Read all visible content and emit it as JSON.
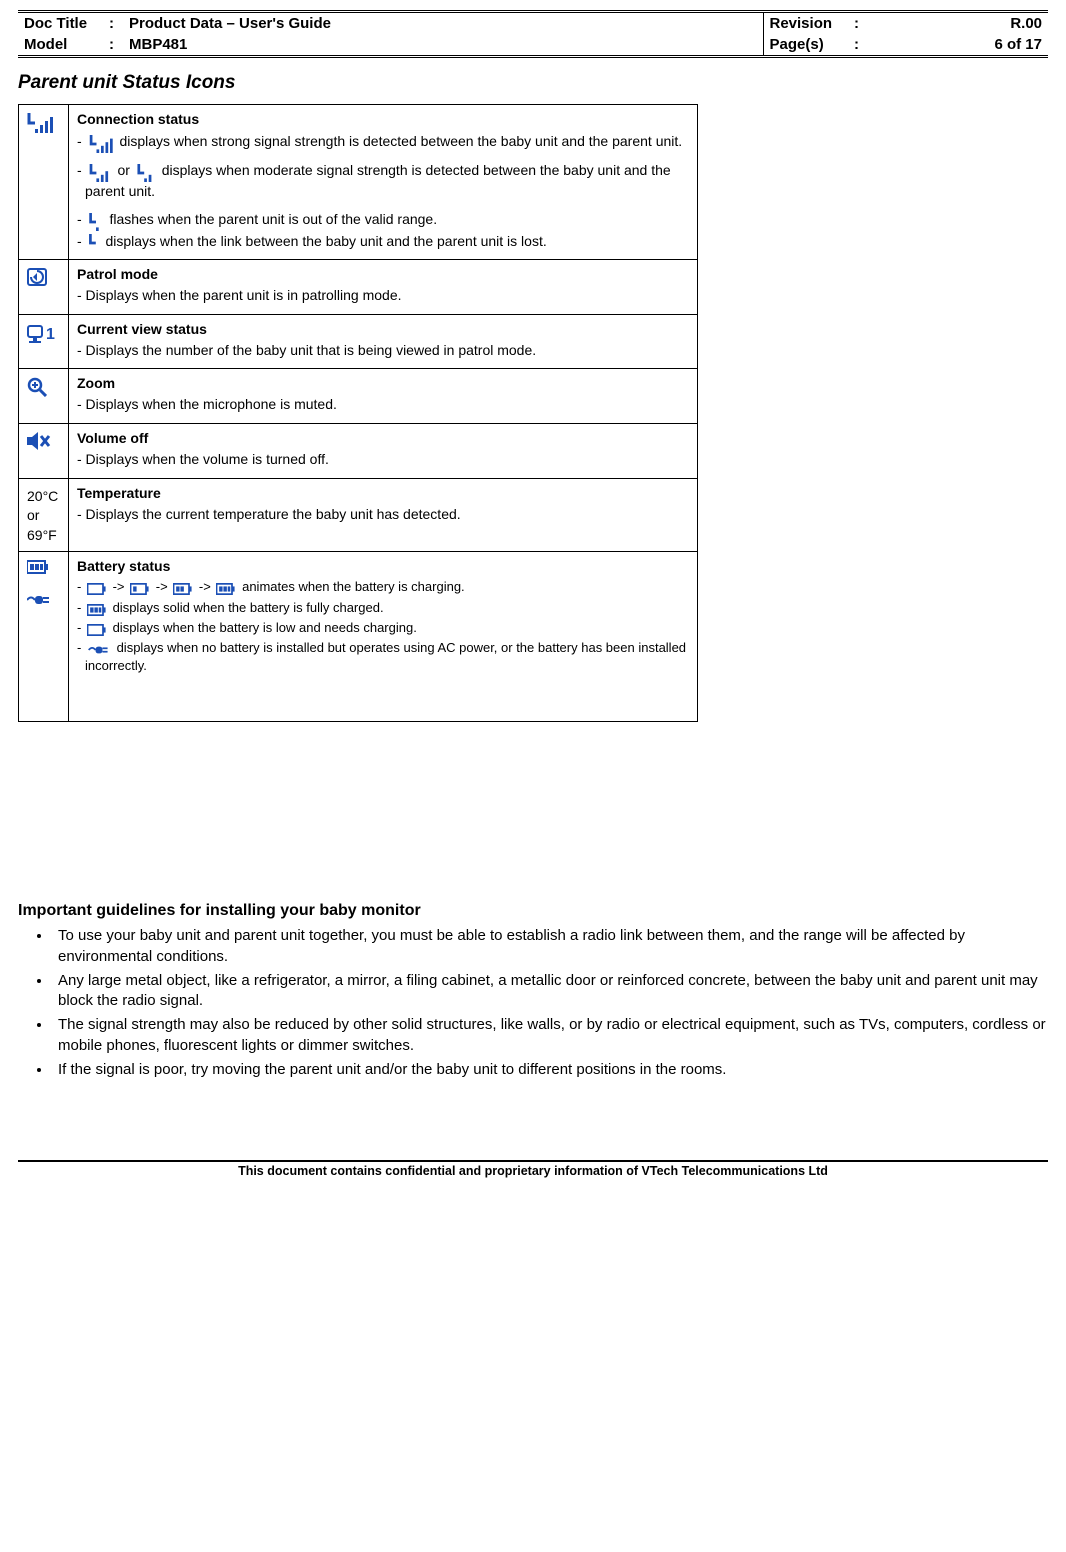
{
  "header": {
    "docTitleLabel": "Doc Title",
    "docTitleValue": "Product Data – User's Guide",
    "modelLabel": "Model",
    "modelValue": "MBP481",
    "revisionLabel": "Revision",
    "revisionValue": "R.00",
    "pagesLabel": "Page(s)",
    "pagesValue": "6 of 17",
    "colon": ":"
  },
  "section": {
    "title": "Parent unit Status Icons"
  },
  "rows": {
    "conn": {
      "title": "Connection status",
      "l1a": "- ",
      "l1b": " displays when strong signal strength is detected between the baby unit and the parent unit.",
      "l2a": "- ",
      "l2b": " or ",
      "l2c": " displays when moderate signal strength is detected between the baby unit and the parent unit.",
      "l3a": "- ",
      "l3b": " flashes when the parent unit is out of the valid range.",
      "l4a": "- ",
      "l4b": " displays when the link between the baby unit and the parent unit is lost."
    },
    "patrol": {
      "title": "Patrol mode",
      "l1": "- Displays when the parent unit is in patrolling mode."
    },
    "view": {
      "title": "Current view status",
      "l1": "- Displays the number of the baby unit that is being viewed in patrol mode."
    },
    "zoom": {
      "title": "Zoom",
      "l1": "- Displays when the microphone is muted."
    },
    "vol": {
      "title": "Volume off",
      "l1": "- Displays when the volume is turned off."
    },
    "temp": {
      "iconText": "20°C or 69°F",
      "title": "Temperature",
      "l1": "- Displays the current temperature the baby unit has detected."
    },
    "batt": {
      "title": "Battery status",
      "l1a": "- ",
      "l1b": "->",
      "l1c": "->",
      "l1d": "->",
      "l1e": " animates when the battery is charging.",
      "l2a": "- ",
      "l2b": " displays solid when the battery is fully charged.",
      "l3a": "- ",
      "l3b": " displays when the battery is low and needs charging.",
      "l4a": "- ",
      "l4b": " displays when no battery is installed but operates using AC power, or the battery has been installed incorrectly."
    }
  },
  "guidelines": {
    "title": "Important guidelines for installing your baby monitor",
    "items": [
      "To use your baby unit and parent unit together, you must be able to establish a radio link between them, and the range will be affected by environmental conditions.",
      "Any large metal object, like a refrigerator, a mirror, a filing cabinet, a metallic door or reinforced concrete, between the baby unit and parent unit may block the radio signal.",
      "The signal strength may also be reduced by other solid structures, like walls, or by radio or electrical equipment, such as TVs, computers, cordless or mobile phones, fluorescent lights or dimmer switches.",
      "If the signal is poor, try moving the parent unit and/or the baby unit to different positions in the rooms."
    ]
  },
  "footer": "This document contains confidential and proprietary information of VTech Telecommunications Ltd"
}
